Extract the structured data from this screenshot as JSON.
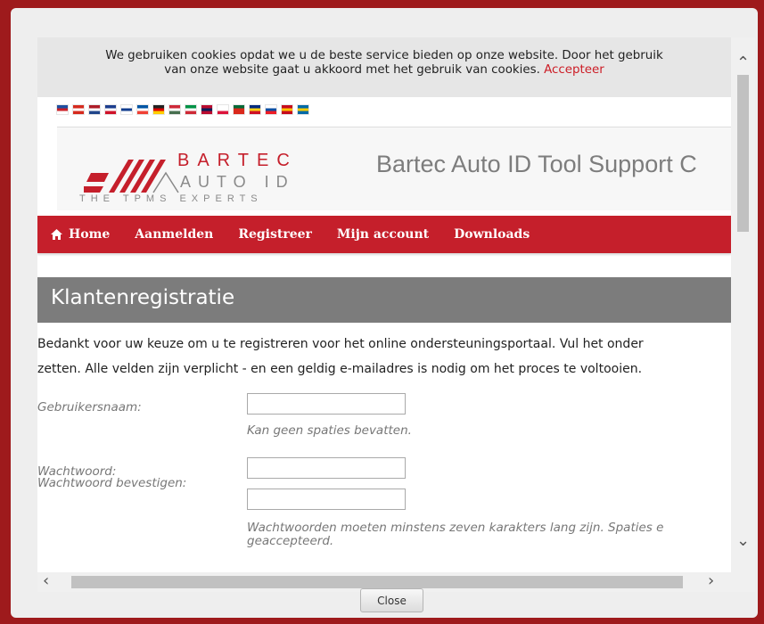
{
  "cookie_banner": {
    "line1": "We gebruiken cookies opdat we u de beste service bieden op onze website. Door het gebruik",
    "line2_text": "van onze website gaat u akkoord met het gebruik van cookies.",
    "accept_label": "Accepteer"
  },
  "flags": [
    {
      "name": "flag-czech-icon",
      "c1": "#1f4fa0",
      "c2": "#cc2027",
      "c3": "#ffffff"
    },
    {
      "name": "flag-denmark-icon",
      "c1": "#d52b1e",
      "c2": "#ffffff",
      "c3": "#d52b1e"
    },
    {
      "name": "flag-netherlands-icon",
      "c1": "#ae1c28",
      "c2": "#ffffff",
      "c3": "#21468b"
    },
    {
      "name": "flag-uk-icon",
      "c1": "#1d3f8e",
      "c2": "#ffffff",
      "c3": "#cf142b"
    },
    {
      "name": "flag-finland-icon",
      "c1": "#ffffff",
      "c2": "#113d8e",
      "c3": "#ffffff"
    },
    {
      "name": "flag-france-icon",
      "c1": "#0055a4",
      "c2": "#ffffff",
      "c3": "#ef4135"
    },
    {
      "name": "flag-germany-icon",
      "c1": "#222222",
      "c2": "#dd0000",
      "c3": "#ffce00"
    },
    {
      "name": "flag-hungary-icon",
      "c1": "#ce2939",
      "c2": "#ffffff",
      "c3": "#477050"
    },
    {
      "name": "flag-italy-icon",
      "c1": "#009246",
      "c2": "#ffffff",
      "c3": "#ce2b37"
    },
    {
      "name": "flag-norway-icon",
      "c1": "#ba0c2f",
      "c2": "#00205b",
      "c3": "#ba0c2f"
    },
    {
      "name": "flag-poland-icon",
      "c1": "#ffffff",
      "c2": "#ffffff",
      "c3": "#dc143c"
    },
    {
      "name": "flag-portugal-icon",
      "c1": "#046a38",
      "c2": "#da291c",
      "c3": "#da291c"
    },
    {
      "name": "flag-romania-icon",
      "c1": "#002b7f",
      "c2": "#fcd116",
      "c3": "#ce1126"
    },
    {
      "name": "flag-slovakia-icon",
      "c1": "#ffffff",
      "c2": "#0b4ea2",
      "c3": "#ee1c25"
    },
    {
      "name": "flag-spain-icon",
      "c1": "#c60b1e",
      "c2": "#ffc400",
      "c3": "#c60b1e"
    },
    {
      "name": "flag-sweden-icon",
      "c1": "#006aa7",
      "c2": "#fecc00",
      "c3": "#006aa7"
    }
  ],
  "logo": {
    "line1": "BARTEC",
    "line2": "AUTO ID",
    "tagline": "THE TPMS EXPERTS"
  },
  "site_title": "Bartec Auto ID Tool Support C",
  "nav": {
    "home": "Home",
    "login": "Aanmelden",
    "register": "Registreer",
    "account": "Mijn account",
    "downloads": "Downloads"
  },
  "page": {
    "title": "Klantenregistratie",
    "intro_line1": "Bedankt voor uw keuze om u te registreren voor het online ondersteuningsportaal. Vul het onder",
    "intro_line2": "zetten. Alle velden zijn verplicht - en een geldig e-mailadres is nodig om het proces te voltooien."
  },
  "form": {
    "username_label": "Gebruikersnaam:",
    "username_value": "",
    "username_hint": "Kan geen spaties bevatten.",
    "password_label": "Wachtwoord:",
    "password_confirm_label": "Wachtwoord bevestigen:",
    "password_value": "",
    "password_confirm_value": "",
    "password_hint_line1": "Wachtwoorden moeten minstens zeven karakters lang zijn. Spaties e",
    "password_hint_line2": "geaccepteerd."
  },
  "colors": {
    "brand_red": "#c51f2b",
    "frame_red": "#9e1a1c",
    "page_head_gray": "#7c7c7c"
  },
  "dialog": {
    "close_label": "Close"
  }
}
